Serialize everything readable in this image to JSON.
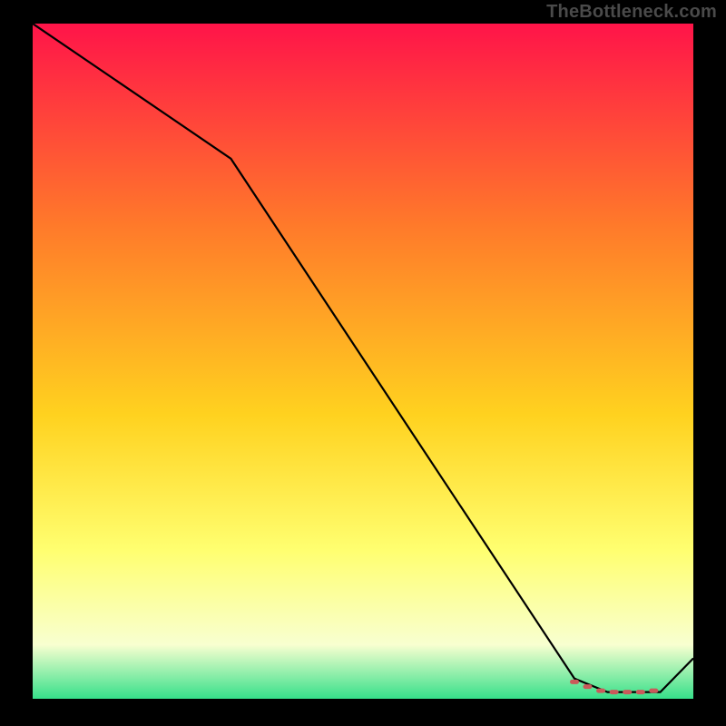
{
  "watermark": "TheBottleneck.com",
  "colors": {
    "frame_bg": "#000000",
    "watermark_text": "#4a4a4a",
    "gradient_top": "#ff1449",
    "gradient_upper_mid": "#ff7a2a",
    "gradient_mid": "#ffd21f",
    "gradient_lower_mid": "#ffff70",
    "gradient_low": "#f8ffd0",
    "gradient_bottom": "#36e08a",
    "line_main": "#000000",
    "markers": "#c95a5a"
  },
  "chart_data": {
    "type": "line",
    "title": "",
    "xlabel": "",
    "ylabel": "",
    "xlim": [
      0,
      100
    ],
    "ylim": [
      0,
      100
    ],
    "grid": false,
    "legend": false,
    "series": [
      {
        "name": "main-line",
        "x": [
          0,
          30,
          82,
          87,
          95,
          100
        ],
        "y": [
          100,
          80,
          3,
          1,
          1,
          6
        ]
      }
    ],
    "markers": {
      "name": "highlight-range",
      "x": [
        82,
        84,
        86,
        88,
        90,
        92,
        94
      ],
      "y": [
        2.5,
        1.8,
        1.2,
        1.0,
        1.0,
        1.0,
        1.2
      ]
    }
  }
}
